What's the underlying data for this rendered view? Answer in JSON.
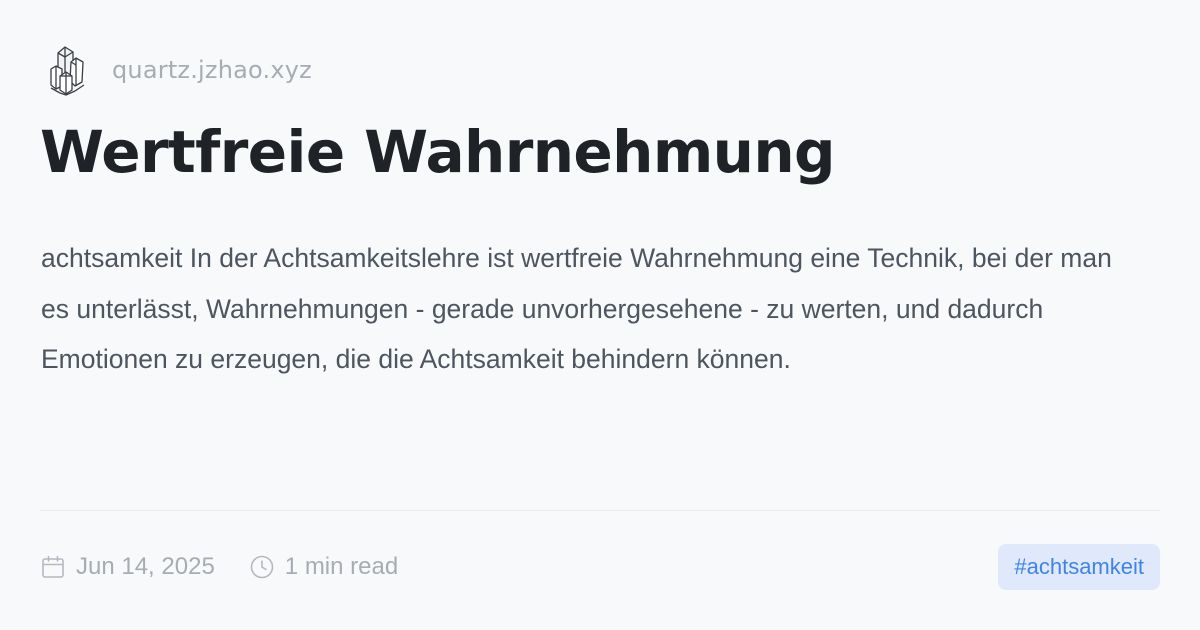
{
  "site": {
    "name": "quartz.jzhao.xyz",
    "logo_icon": "crystal-icon"
  },
  "page": {
    "title": "Wertfreie Wahrnehmung",
    "description": "achtsamkeit In der Achtsamkeitslehre ist wertfreie Wahrnehmung eine Technik, bei der man es unterlässt, Wahrnehmungen - gerade unvorhergesehene - zu werten, und dadurch Emotionen zu erzeugen, die die Achtsamkeit behindern können."
  },
  "meta": {
    "date": "Jun 14, 2025",
    "date_icon": "calendar-icon",
    "read_time": "1 min read",
    "read_time_icon": "clock-icon"
  },
  "tags": [
    {
      "label": "#achtsamkeit"
    }
  ],
  "colors": {
    "background": "#f8f9fb",
    "title": "#1f2327",
    "text": "#4d5560",
    "muted": "#a7acb3",
    "tag_bg": "#dfe9fb",
    "tag_text": "#3f83e8",
    "divider": "#e6e9ee"
  }
}
